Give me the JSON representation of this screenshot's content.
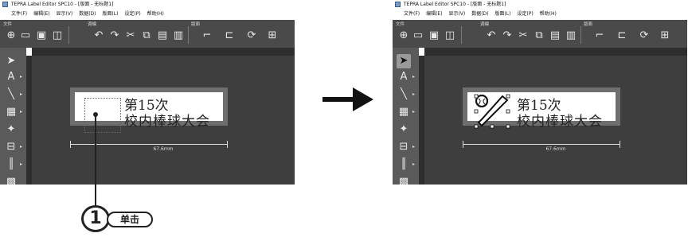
{
  "titlebar": {
    "title": "TEPRA Label Editor SPC10 - [版面 - 无标题1]"
  },
  "menubar": {
    "items": [
      "文件(F)",
      "编辑(E)",
      "显示(V)",
      "数据(D)",
      "版面(L)",
      "设定(P)",
      "帮助(H)"
    ]
  },
  "toolbar": {
    "group_file": "文件",
    "group_edit": "调编",
    "group_layout": "版面"
  },
  "tools": [
    "select-arrow-icon",
    "text-tool-icon",
    "line-tool-icon",
    "image-tool-icon",
    "stamp-tool-icon",
    "frame-tool-icon",
    "barcode-tool-icon",
    "qrcode-tool-icon"
  ],
  "label": {
    "line1": "第15次",
    "line2": "校内棒球大会",
    "dimension": "67.6mm"
  },
  "instruction": {
    "step_number": "1",
    "action": "单击"
  },
  "colors": {
    "toolbar": "#4a4a4a",
    "canvas": "#3e3e3e",
    "tape": "#6e6e6e"
  }
}
